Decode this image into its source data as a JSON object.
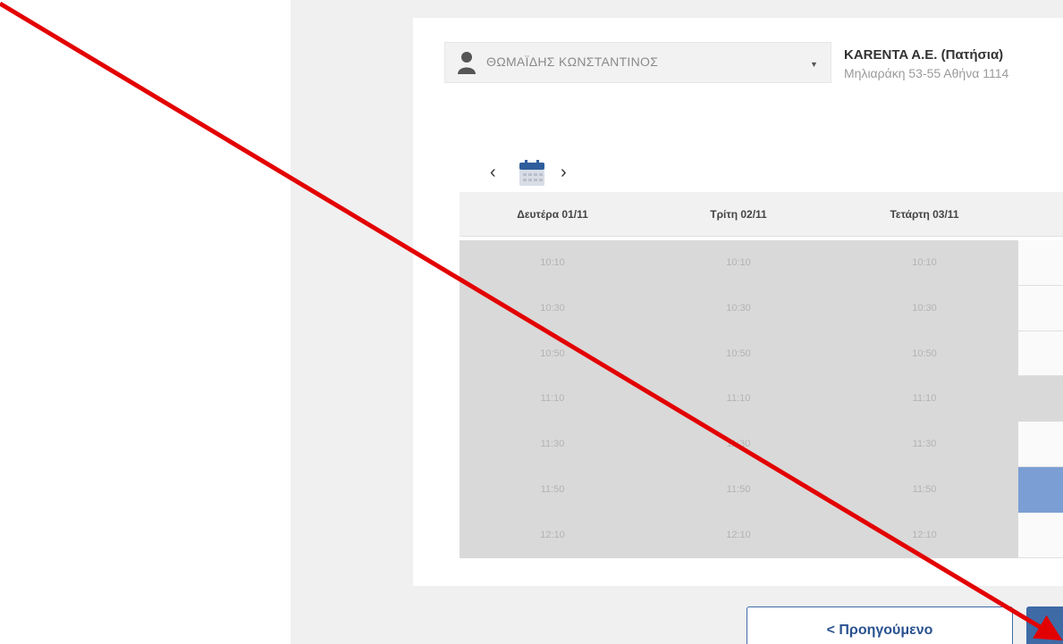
{
  "selector": {
    "person_label": "ΘΩΜΑΪΔΗΣ ΚΩΝΣΤΑΝΤΙΝΟΣ",
    "caret": "▼"
  },
  "company": {
    "name": "KARENTA A.E. (Πατήσια)",
    "address": "Μηλιαράκη 53-55 Αθήνα 1114"
  },
  "nav": {
    "prev": "‹",
    "next": "›"
  },
  "table": {
    "headers": [
      "Δευτέρα 01/11",
      "Τρίτη 02/11",
      "Τετάρτη 03/11"
    ],
    "times": [
      "10:10",
      "10:30",
      "10:50",
      "11:10",
      "11:30",
      "11:50",
      "12:10"
    ],
    "fourth_column_states": [
      "white",
      "white",
      "white",
      "grey",
      "white",
      "blue",
      "white"
    ]
  },
  "buttons": {
    "previous_label": "< Προηγούμενο"
  },
  "colors": {
    "primary": "#3e6aa6",
    "slot_selected": "#7b9ed4",
    "slot_unavailable": "#d9d9d9",
    "annotation_arrow": "#e30000"
  }
}
